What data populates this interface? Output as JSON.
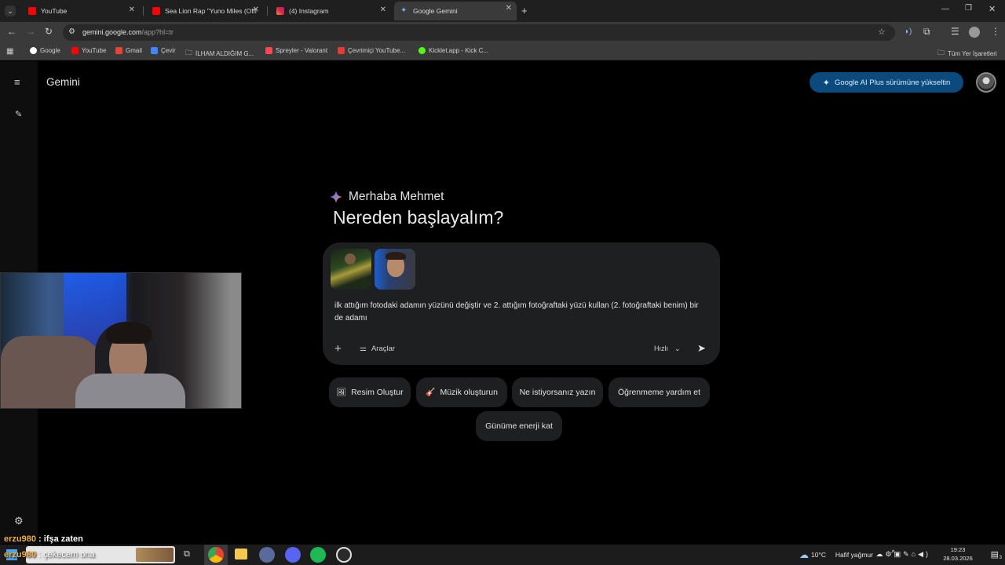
{
  "tabs": [
    {
      "title": "YouTube",
      "color": "#ff0000"
    },
    {
      "title": "Sea Lion Rap \"Yuno Miles (Offi",
      "color": "#ff0000"
    },
    {
      "title": "(4) Instagram",
      "color": "#d6249f"
    },
    {
      "title": "Google Gemini",
      "color": "#7aa7ff"
    }
  ],
  "toolbar": {
    "url_host": "gemini.google.com",
    "url_path": "/app?hl=tr"
  },
  "bookmarks": [
    {
      "label": "Google",
      "color": "#4285f4"
    },
    {
      "label": "YouTube",
      "color": "#ff0000"
    },
    {
      "label": "Gmail",
      "color": "#ea4335"
    },
    {
      "label": "Çevir",
      "color": "#4285f4"
    },
    {
      "label": "İLHAM ALDIĞIM G...",
      "color": "folder"
    },
    {
      "label": "Spreyler - Valorant",
      "color": "#ff4655"
    },
    {
      "label": "Çevrimiçi YouTube...",
      "color": "#e53935"
    },
    {
      "label": "Kicklet.app - Kick C...",
      "color": "#53fc18"
    }
  ],
  "bookmarks_all": "Tüm Yer İşaretleri",
  "app": {
    "logo": "Gemini",
    "upgrade_label": "Google AI Plus sürümüne yükseltin",
    "greeting": "Merhaba Mehmet",
    "headline": "Nereden başlayalım?",
    "prompt_text": "ilk attığım fotodaki adamın yüzünü değiştir ve 2. attığım fotoğraftaki yüzü kullan (2. fotoğraftaki benim) bir de adamı",
    "tools_label": "Araçlar",
    "mode_label": "Hızlı",
    "chips": [
      {
        "label": "Resim Oluştur",
        "icon": "image-icon"
      },
      {
        "label": "Müzik oluşturun",
        "icon": "music-icon"
      },
      {
        "label": "Ne istiyorsanız yazın",
        "icon": ""
      },
      {
        "label": "Öğrenmeme yardım et",
        "icon": ""
      },
      {
        "label": "Günüme enerji kat",
        "icon": ""
      }
    ]
  },
  "chat": [
    {
      "user": "erzu980",
      "message": ": ifşa zaten"
    },
    {
      "user": "erzu980",
      "message": ": çekecem ona"
    }
  ],
  "taskbar": {
    "weather_temp": "10°C",
    "weather_desc": "Hafif yağmur",
    "time": "19:23",
    "date": "28.03.2026",
    "notif_count": "3"
  }
}
